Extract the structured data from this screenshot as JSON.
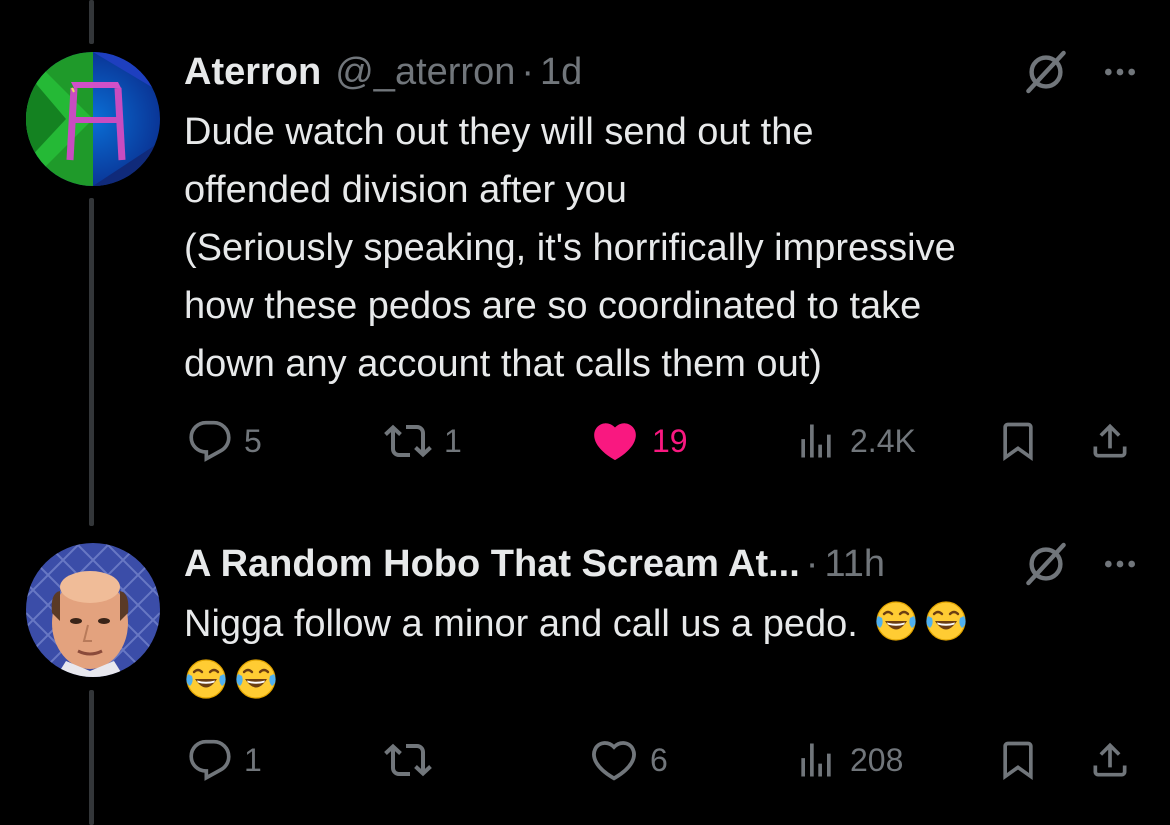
{
  "colors": {
    "background": "#000000",
    "text": "#e7e9ea",
    "muted": "#71767b",
    "like": "#f91880",
    "thread_line": "#333639"
  },
  "tweets": [
    {
      "name": "Aterron",
      "handle": "@_aterron",
      "separator": "·",
      "time": "1d",
      "text_lines": [
        "Dude watch out they will send out the",
        "offended division after you",
        "(Seriously speaking, it's horrifically impressive",
        "how these pedos are so coordinated to take",
        "down any account that calls them out)"
      ],
      "replies": "5",
      "reposts": "1",
      "likes": "19",
      "liked": true,
      "views": "2.4K",
      "icons": [
        "grok-icon",
        "more-icon",
        "reply-icon",
        "repost-icon",
        "like-icon",
        "views-icon",
        "bookmark-icon",
        "share-icon"
      ]
    },
    {
      "name": "A Random Hobo That Scream At...",
      "separator": "·",
      "time": "11h",
      "text": "Nigga follow a minor and call us a pedo.",
      "emojis": [
        "face-with-tears-of-joy",
        "face-with-tears-of-joy",
        "face-with-tears-of-joy",
        "face-with-tears-of-joy"
      ],
      "replies": "1",
      "reposts": "",
      "likes": "6",
      "liked": false,
      "views": "208",
      "icons": [
        "grok-icon",
        "more-icon",
        "reply-icon",
        "repost-icon",
        "like-icon",
        "views-icon",
        "bookmark-icon",
        "share-icon"
      ]
    }
  ]
}
